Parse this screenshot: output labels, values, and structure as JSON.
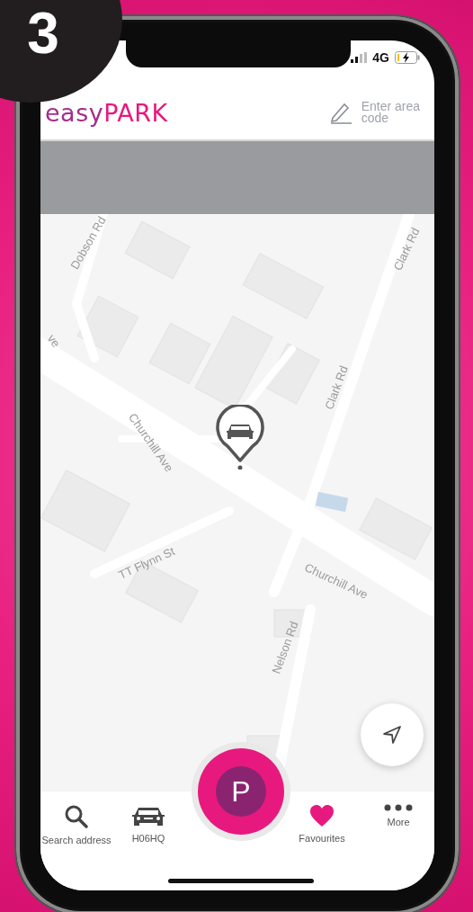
{
  "step_badge": "3",
  "status_bar": {
    "network": "4G"
  },
  "header": {
    "logo": {
      "first": "easy",
      "second": "PARK"
    },
    "area_code_button": "Enter area\ncode"
  },
  "map": {
    "labels": [
      "Dobson Rd",
      "Clark Rd",
      "ve",
      "Clark Rd",
      "Churchill Ave",
      "TT Flynn St",
      "Churchill Ave",
      "Nelson Rd"
    ]
  },
  "park_button": "P",
  "nav": [
    {
      "kind": "search",
      "label": "Search address"
    },
    {
      "kind": "car",
      "label": "H06HQ"
    },
    {
      "kind": "heart",
      "label": "Favourites"
    },
    {
      "kind": "more",
      "label": "More"
    }
  ]
}
